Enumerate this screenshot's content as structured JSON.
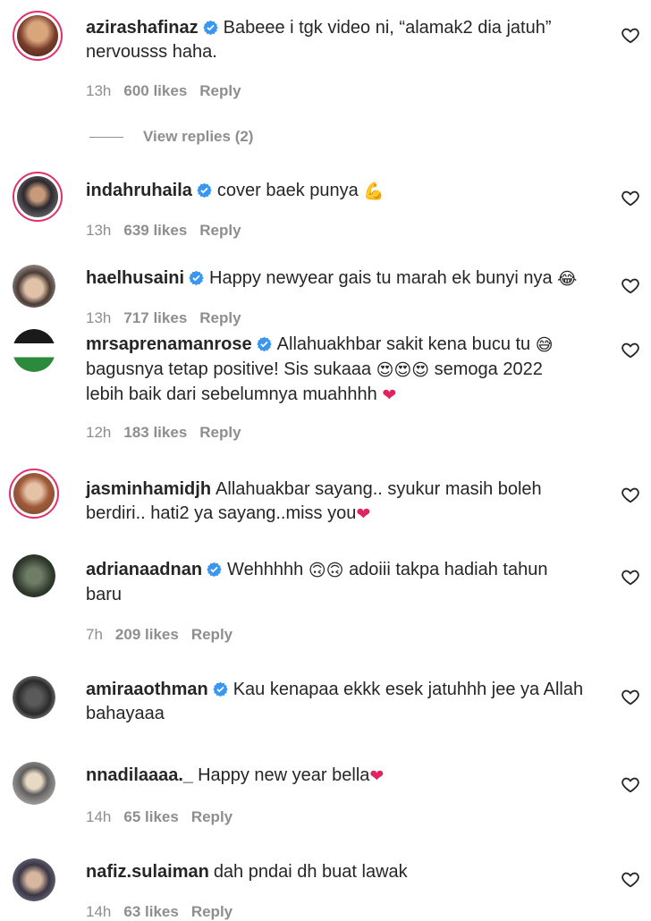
{
  "comments": [
    {
      "username": "azirashafinaz",
      "text": "Babeee i tgk video ni, “alamak2 dia jatuh”",
      "text2": "nervousss haha.",
      "time": "13h",
      "likes": "600 likes",
      "reply": "Reply"
    },
    {
      "username": "indahruhaila",
      "text": "cover baek punya",
      "time": "13h",
      "likes": "639 likes",
      "reply": "Reply"
    },
    {
      "username": "haelhusaini",
      "text": "Happy newyear gais tu marah ek bunyi nya",
      "time": "13h",
      "likes": "717 likes",
      "reply": "Reply"
    },
    {
      "username": "mrsaprenamanrose",
      "text": "Allahuakhbar sakit kena bucu tu",
      "text2a": "bagusnya tetap positive! Sis sukaaa",
      "text2b": "semoga 2022",
      "text3": "lebih baik dari sebelumnya muahhhh",
      "time": "12h",
      "likes": "183 likes",
      "reply": "Reply"
    },
    {
      "username": "jasminhamidjh",
      "text": "Allahuakbar sayang.. syukur masih boleh",
      "text2": "berdiri.. hati2 ya sayang..miss you"
    },
    {
      "username": "adrianaadnan",
      "text": "Wehhhhh",
      "text_b": "adoiii takpa hadiah tahun",
      "text2": "baru",
      "time": "7h",
      "likes": "209 likes",
      "reply": "Reply"
    },
    {
      "username": "amiraaothman",
      "text": "Kau kenapaa ekkk esek jatuhhh jee ya Allah",
      "text2": "bahayaaa"
    },
    {
      "username": "nnadilaaaa._",
      "text": "Happy new year bella",
      "time": "14h",
      "likes": "65 likes",
      "reply": "Reply"
    },
    {
      "username": "nafiz.sulaiman",
      "text": "dah pndai dh buat lawak",
      "time": "14h",
      "likes": "63 likes",
      "reply": "Reply"
    }
  ],
  "view_replies": "View replies (2)",
  "icons": {
    "heart": "heart-outline-icon",
    "verified": "verified-badge-icon"
  },
  "colors": {
    "verified": "#3897f0",
    "muted": "#8e8e8e",
    "story_ring": "#e1306c",
    "emoji_heart": "#e0245e"
  }
}
